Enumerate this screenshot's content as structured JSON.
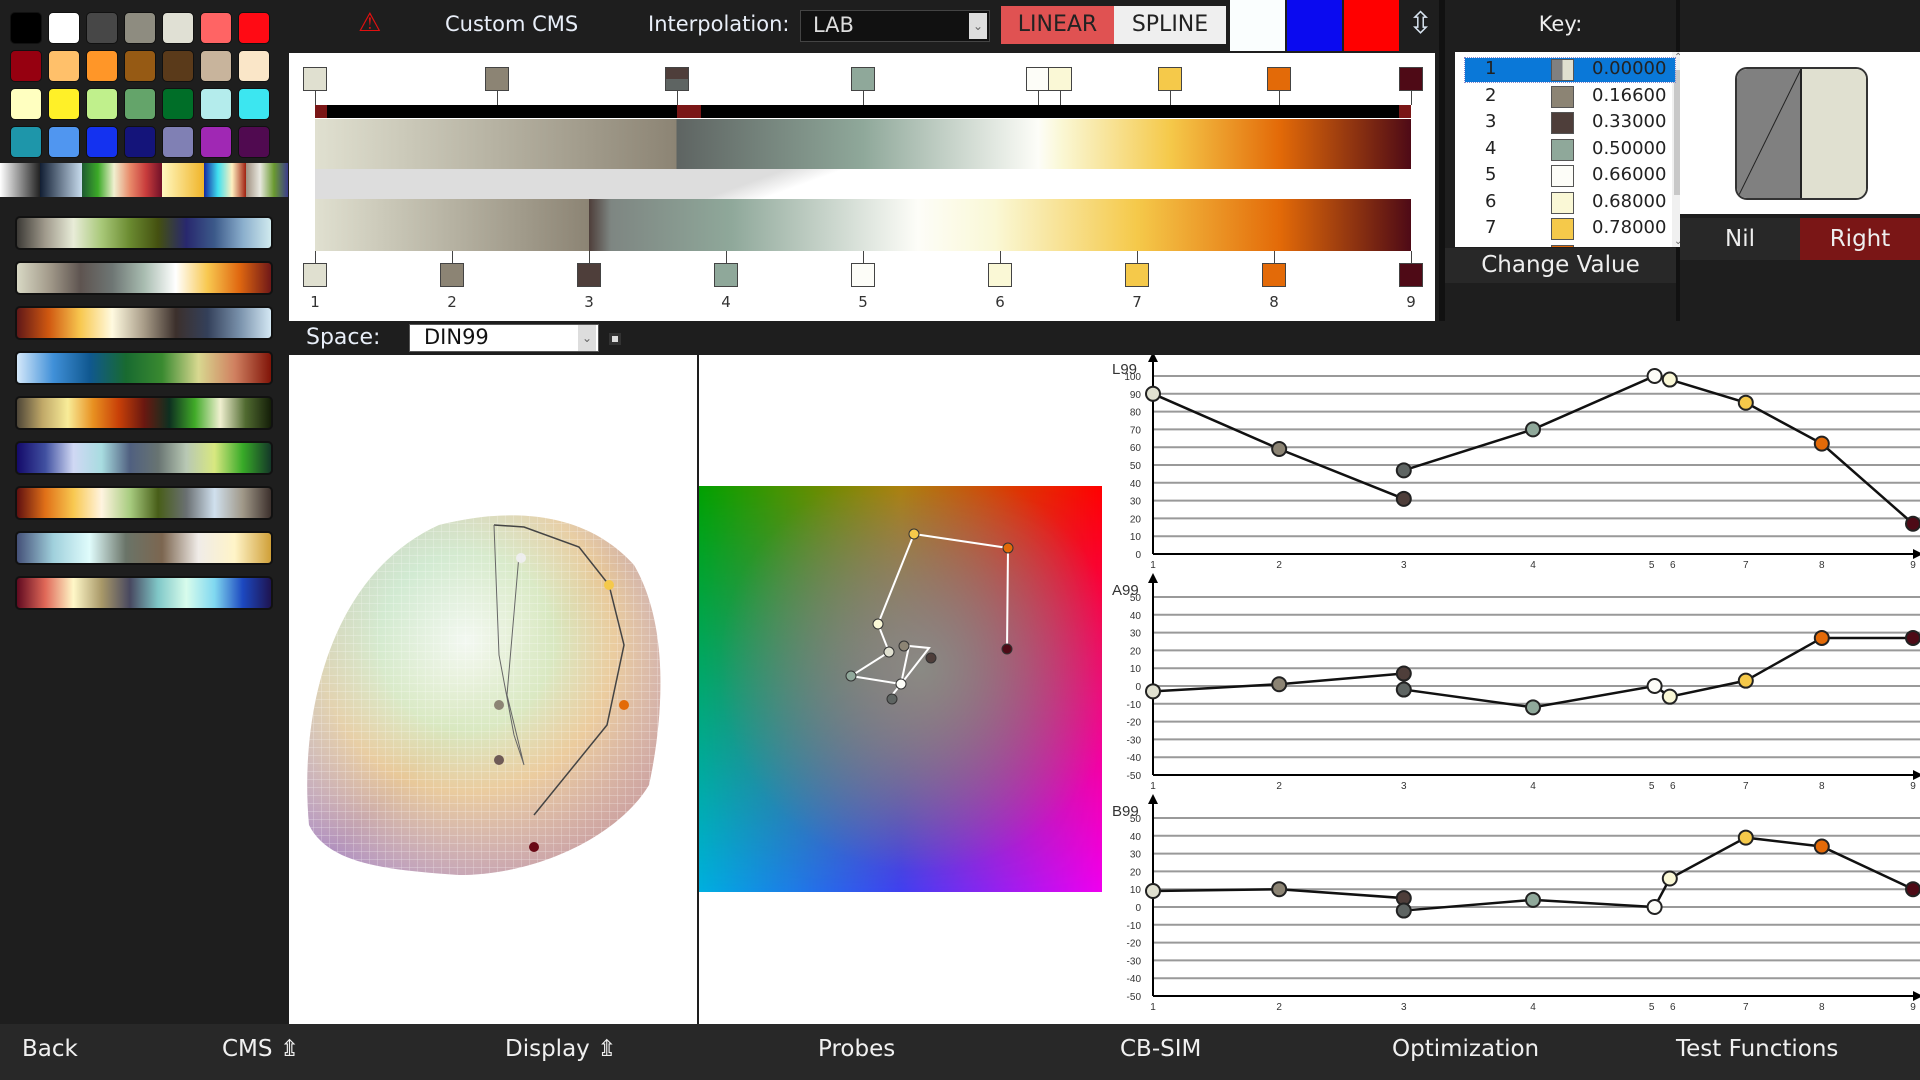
{
  "palette": [
    [
      "#000000",
      "#ffffff",
      "#474747",
      "#8e8c80",
      "#e0e0d4",
      "#ff6464",
      "#ff0a14"
    ],
    [
      "#960010",
      "#ffc06a",
      "#ff9628",
      "#965a14",
      "#5a3a1a",
      "#c8b49c",
      "#fae6c8"
    ],
    [
      "#ffffc0",
      "#fff028",
      "#c0f08c",
      "#64a46a",
      "#006e28",
      "#b4ecec",
      "#3ce6f0"
    ],
    [
      "#1e96aa",
      "#5096f0",
      "#1432f0",
      "#14147a",
      "#8080b4",
      "#a028b4",
      "#500a50"
    ]
  ],
  "strips": [
    [
      "#fff",
      "#222"
    ],
    [
      "#111e33",
      "#c8dcee"
    ],
    [
      "#1e5a32",
      "#3caa28",
      "#f0f0d0",
      "#e88a6a",
      "#c83c3c",
      "#701028"
    ],
    [
      "#fff8c0",
      "#f0b428"
    ],
    [
      "#1428a0",
      "#40e0f0",
      "#fff0c0",
      "#a02010"
    ],
    [
      "#a09080",
      "#e8e8e0",
      "#6a9a30",
      "#3c3c8c"
    ]
  ],
  "colormaps": [
    [
      "#3c3a36",
      "#a09a8c",
      "#e8ecd8",
      "#a8c878",
      "#6a8a30",
      "#445010",
      "#28286e",
      "#3c5a8a",
      "#8aaecc",
      "#d0eaee"
    ],
    [
      "#d8d8c4",
      "#a49c8c",
      "#5e5450",
      "#6e7674",
      "#a8bcb0",
      "#ffffff",
      "#f8c850",
      "#e06810",
      "#701818"
    ],
    [
      "#601818",
      "#d05810",
      "#f8c850",
      "#fffae0",
      "#a89c88",
      "#3c302c",
      "#34405a",
      "#7890aa",
      "#d4e8f4"
    ],
    [
      "#d4e8fa",
      "#4090d8",
      "#105890",
      "#186a30",
      "#3a8a30",
      "#d8d890",
      "#d08060",
      "#801408"
    ],
    [
      "#4e4638",
      "#c0a868",
      "#f8ec98",
      "#e89020",
      "#c84008",
      "#6a1810",
      "#0e3020",
      "#40aa28",
      "#f0f0d0",
      "#506a30",
      "#141e08"
    ],
    [
      "#140a6a",
      "#4050a0",
      "#d0d8f4",
      "#a8dce0",
      "#506080",
      "#687472",
      "#b8c8b4",
      "#d8e880",
      "#38aa28",
      "#143828"
    ],
    [
      "#601010",
      "#e07018",
      "#f8c850",
      "#fff4e0",
      "#a8cc80",
      "#485e18",
      "#6a7072",
      "#d0e0ee",
      "#a09888",
      "#3c302c"
    ],
    [
      "#445078",
      "#a0d0dc",
      "#e0fcfc",
      "#6a7468",
      "#7c6650",
      "#f0ece8",
      "#fff4c8",
      "#d0a038"
    ],
    [
      "#600a20",
      "#e06858",
      "#fff8c8",
      "#a89868",
      "#484860",
      "#80c8c8",
      "#d8fcec",
      "#80d8f0",
      "#1c48c0",
      "#1e1450"
    ]
  ],
  "header": {
    "warning_icon": "warning-triangle-icon",
    "title": "Custom CMS",
    "interpolation_label": "Interpolation:",
    "interpolation_value": "LAB",
    "linear_label": "LINEAR",
    "spline_label": "SPLINE",
    "color_boxes": [
      "#fafefe",
      "#0a0af0",
      "#ff0000"
    ],
    "swap_icon": "up-down-arrow-icon"
  },
  "keys": [
    {
      "n": "1",
      "pos": 0.0,
      "val": "0.00000",
      "c": "#e0e0d0",
      "c2": "#808080"
    },
    {
      "n": "2",
      "pos": 0.166,
      "val": "0.16600",
      "c": "#8c8474"
    },
    {
      "n": "3",
      "pos": 0.33,
      "val": "0.33000",
      "c": "#4e3e3a",
      "c2": "#5e6462"
    },
    {
      "n": "4",
      "pos": 0.5,
      "val": "0.50000",
      "c": "#8fa89a"
    },
    {
      "n": "5",
      "pos": 0.66,
      "val": "0.66000",
      "c": "#fdfdf8"
    },
    {
      "n": "6",
      "pos": 0.68,
      "val": "0.68000",
      "c": "#faf8d6"
    },
    {
      "n": "7",
      "pos": 0.78,
      "val": "0.78000",
      "c": "#f5c94a"
    },
    {
      "n": "8",
      "pos": 0.88,
      "c": "#e36a08"
    },
    {
      "n": "9",
      "pos": 1.0,
      "c": "#4e0a16"
    }
  ],
  "key_panel": {
    "title": "Key:",
    "change_value": "Change Value"
  },
  "preview": {
    "nil_label": "Nil",
    "right_label": "Right",
    "left_color": "#808080",
    "right_color": "#e0e0d0",
    "accent": "#7a1616"
  },
  "space": {
    "label": "Space:",
    "value": "DIN99"
  },
  "chart_data": [
    {
      "type": "line",
      "ylabel": "L99",
      "ylim": [
        0,
        100
      ],
      "yticks": [
        0,
        10,
        20,
        30,
        40,
        50,
        60,
        70,
        80,
        90,
        100
      ],
      "xticks": [
        "1",
        "2",
        "3",
        "4",
        "5",
        "6",
        "7",
        "8",
        "9"
      ],
      "points": [
        [
          0,
          90
        ],
        [
          0.166,
          59
        ],
        [
          0.33,
          31
        ],
        [
          0.33,
          47
        ],
        [
          0.5,
          70
        ],
        [
          0.66,
          100
        ],
        [
          0.68,
          98
        ],
        [
          0.78,
          85
        ],
        [
          0.88,
          62
        ],
        [
          1,
          17
        ]
      ]
    },
    {
      "type": "line",
      "ylabel": "A99",
      "ylim": [
        -50,
        50
      ],
      "yticks": [
        -50,
        -40,
        -30,
        -20,
        -10,
        0,
        10,
        20,
        30,
        40,
        50
      ],
      "xticks": [
        "1",
        "2",
        "3",
        "4",
        "5",
        "6",
        "7",
        "8",
        "9"
      ],
      "points": [
        [
          0,
          -3
        ],
        [
          0.166,
          1
        ],
        [
          0.33,
          7
        ],
        [
          0.33,
          -2
        ],
        [
          0.5,
          -12
        ],
        [
          0.66,
          0
        ],
        [
          0.68,
          -6
        ],
        [
          0.78,
          3
        ],
        [
          0.88,
          27
        ],
        [
          1,
          27
        ]
      ]
    },
    {
      "type": "line",
      "ylabel": "B99",
      "ylim": [
        -50,
        50
      ],
      "yticks": [
        -50,
        -40,
        -30,
        -20,
        -10,
        0,
        10,
        20,
        30,
        40,
        50
      ],
      "xticks": [
        "1",
        "2",
        "3",
        "4",
        "5",
        "6",
        "7",
        "8",
        "9"
      ],
      "points": [
        [
          0,
          9
        ],
        [
          0.166,
          10
        ],
        [
          0.33,
          5
        ],
        [
          0.33,
          -2
        ],
        [
          0.5,
          4
        ],
        [
          0.66,
          0
        ],
        [
          0.68,
          16
        ],
        [
          0.78,
          39
        ],
        [
          0.88,
          34
        ],
        [
          1,
          10
        ]
      ]
    }
  ],
  "point_colors": [
    "#e0e0d0",
    "#8c8474",
    "#4e3e3a",
    "#5e6462",
    "#8fa89a",
    "#fdfdf8",
    "#faf8d6",
    "#f5c94a",
    "#e36a08",
    "#4e0a16"
  ],
  "nav": [
    "Back",
    "CMS ⇭",
    "Display ⇭",
    "Probes",
    "CB-SIM",
    "Optimization",
    "Test Functions"
  ]
}
